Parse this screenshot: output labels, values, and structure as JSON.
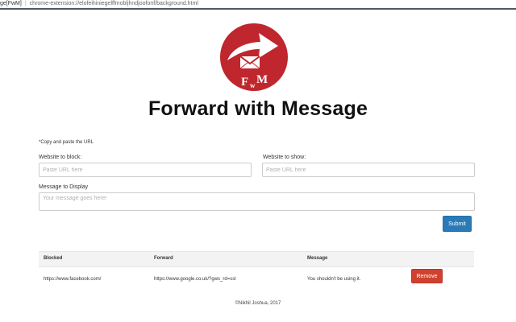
{
  "browser": {
    "tab_title": "ge[FwM]",
    "url": "chrome-extension://elofeihiniegelffmobljhndjoofonf/background.html"
  },
  "logo": {
    "monogram_left": "F",
    "monogram_mid": "w",
    "monogram_right": "M",
    "colors": {
      "circle": "#c0262d",
      "arrow": "#ffffff"
    }
  },
  "header": {
    "title": "Forward with Message"
  },
  "form": {
    "hint": "*Copy and paste the URL",
    "block_label": "Website to block:",
    "block_placeholder": "Paste URL here",
    "show_label": "Website to show:",
    "show_placeholder": "Paste URL here",
    "message_label": "Message to Display",
    "message_placeholder": "Your message goes here!",
    "submit_label": "Submit"
  },
  "table": {
    "columns": [
      "Blocked",
      "Forward",
      "Message"
    ],
    "rows": [
      {
        "blocked": "https://www.facebook.com/",
        "forward": "https://www.google.co.uk/?gws_rd=ssl",
        "message": "You shouldn't be using it.",
        "remove_label": "Remove"
      }
    ]
  },
  "footer": {
    "text": "©Nikhil Joshua, 2017"
  },
  "colors": {
    "primary": "#2a7ab7",
    "danger": "#d0422f",
    "header_row": "#f3f3f3"
  }
}
